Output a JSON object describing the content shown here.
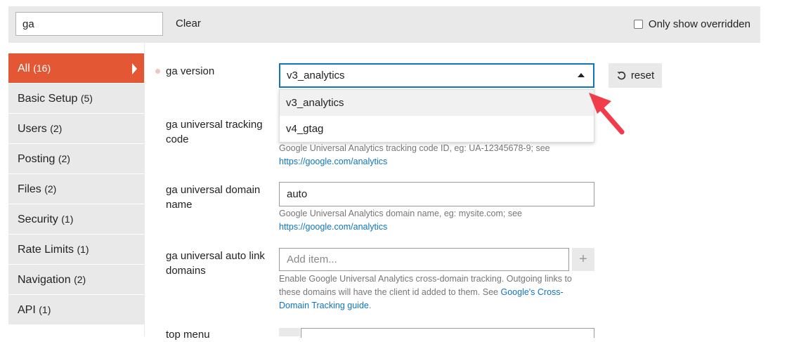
{
  "filter": {
    "value": "ga",
    "clear_label": "Clear",
    "only_overridden_label": "Only show overridden"
  },
  "sidebar": {
    "items": [
      {
        "label": "All",
        "count": "(16)"
      },
      {
        "label": "Basic Setup",
        "count": "(5)"
      },
      {
        "label": "Users",
        "count": "(2)"
      },
      {
        "label": "Posting",
        "count": "(2)"
      },
      {
        "label": "Files",
        "count": "(2)"
      },
      {
        "label": "Security",
        "count": "(1)"
      },
      {
        "label": "Rate Limits",
        "count": "(1)"
      },
      {
        "label": "Navigation",
        "count": "(2)"
      },
      {
        "label": "API",
        "count": "(1)"
      }
    ]
  },
  "settings": {
    "ga_version": {
      "label": "ga version",
      "selected": "v3_analytics",
      "options": [
        "v3_analytics",
        "v4_gtag"
      ],
      "reset_label": "reset"
    },
    "tracking_code": {
      "label": "ga universal tracking code",
      "help": "Google Universal Analytics tracking code ID, eg: UA-12345678-9; see",
      "link": "https://google.com/analytics"
    },
    "domain_name": {
      "label": "ga universal domain name",
      "value": "auto",
      "help": "Google Universal Analytics domain name, eg: mysite.com; see",
      "link": "https://google.com/analytics"
    },
    "auto_link": {
      "label": "ga universal auto link domains",
      "placeholder": "Add item...",
      "add_label": "+",
      "help": "Enable Google Universal Analytics cross-domain tracking. Outgoing links to these domains will have the client id added to them. See",
      "link": "Google's Cross-Domain Tracking guide",
      "suffix": "."
    },
    "top_menu": {
      "label": "top menu"
    }
  },
  "colors": {
    "accent": "#e45735",
    "focus": "#0e76bd",
    "link": "#0e76bd",
    "arrow": "#f03c4b"
  }
}
